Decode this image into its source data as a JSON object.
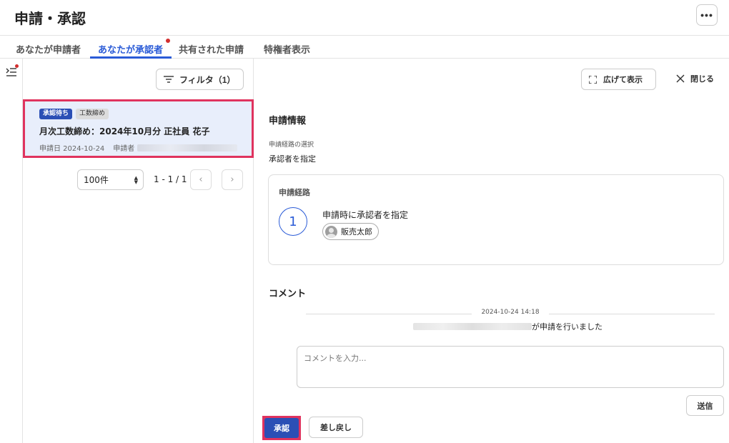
{
  "header": {
    "title": "申請・承認",
    "more_icon": "more-horizontal-icon"
  },
  "tabs": [
    {
      "label": "あなたが申請者",
      "active": false
    },
    {
      "label": "あなたが承認者",
      "active": true,
      "has_notification": true
    },
    {
      "label": "共有された申請",
      "active": false
    },
    {
      "label": "特権者表示",
      "active": false
    }
  ],
  "rail": {
    "icon": "list-collapse-icon",
    "has_notification": true
  },
  "list": {
    "filter_label": "フィルタ（1）",
    "items": [
      {
        "status_badge": "承認待ち",
        "type_badge": "工数締め",
        "title": "月次工数締め：2024年10月分 正社員 花子",
        "date_label": "申請日 2024-10-24",
        "applicant_label": "申請者",
        "selected": true
      }
    ],
    "page_size": "100件",
    "page_range": "1 - 1 / 1",
    "prev_icon": "chevron-left-icon",
    "next_icon": "chevron-right-icon"
  },
  "detail": {
    "expand_label": "広げて表示",
    "close_label": "閉じる",
    "info_title": "申請情報",
    "route_select_label": "申請経路の選択",
    "route_select_value": "承認者を指定",
    "route_box_title": "申請経路",
    "steps": [
      {
        "number": "1",
        "label": "申請時に承認者を指定",
        "approver": "販売太郎"
      }
    ],
    "comment_title": "コメント",
    "timeline_date": "2024-10-24 14:18",
    "activity_text": "が申請を行いました",
    "comment_placeholder": "コメントを入力...",
    "send_label": "送信",
    "approve_label": "承認",
    "sendback_label": "差し戻し"
  },
  "colors": {
    "accent": "#2a5bd7",
    "primary_button": "#2b4fb5",
    "highlight_border": "#e0335e",
    "notification": "#d32f2f",
    "selected_card_bg": "#e8eefb"
  }
}
